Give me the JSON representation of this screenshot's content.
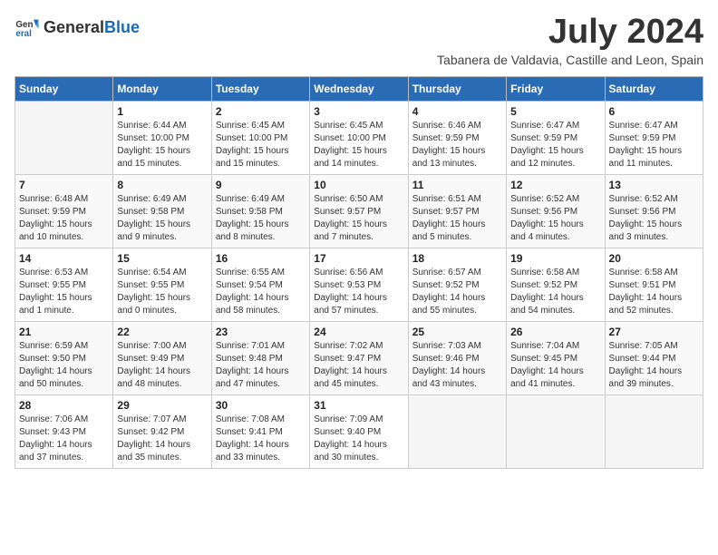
{
  "header": {
    "logo_general": "General",
    "logo_blue": "Blue",
    "month_title": "July 2024",
    "subtitle": "Tabanera de Valdavia, Castille and Leon, Spain"
  },
  "days_of_week": [
    "Sunday",
    "Monday",
    "Tuesday",
    "Wednesday",
    "Thursday",
    "Friday",
    "Saturday"
  ],
  "weeks": [
    [
      {
        "day": "",
        "info": ""
      },
      {
        "day": "1",
        "info": "Sunrise: 6:44 AM\nSunset: 10:00 PM\nDaylight: 15 hours\nand 15 minutes."
      },
      {
        "day": "2",
        "info": "Sunrise: 6:45 AM\nSunset: 10:00 PM\nDaylight: 15 hours\nand 15 minutes."
      },
      {
        "day": "3",
        "info": "Sunrise: 6:45 AM\nSunset: 10:00 PM\nDaylight: 15 hours\nand 14 minutes."
      },
      {
        "day": "4",
        "info": "Sunrise: 6:46 AM\nSunset: 9:59 PM\nDaylight: 15 hours\nand 13 minutes."
      },
      {
        "day": "5",
        "info": "Sunrise: 6:47 AM\nSunset: 9:59 PM\nDaylight: 15 hours\nand 12 minutes."
      },
      {
        "day": "6",
        "info": "Sunrise: 6:47 AM\nSunset: 9:59 PM\nDaylight: 15 hours\nand 11 minutes."
      }
    ],
    [
      {
        "day": "7",
        "info": "Sunrise: 6:48 AM\nSunset: 9:59 PM\nDaylight: 15 hours\nand 10 minutes."
      },
      {
        "day": "8",
        "info": "Sunrise: 6:49 AM\nSunset: 9:58 PM\nDaylight: 15 hours\nand 9 minutes."
      },
      {
        "day": "9",
        "info": "Sunrise: 6:49 AM\nSunset: 9:58 PM\nDaylight: 15 hours\nand 8 minutes."
      },
      {
        "day": "10",
        "info": "Sunrise: 6:50 AM\nSunset: 9:57 PM\nDaylight: 15 hours\nand 7 minutes."
      },
      {
        "day": "11",
        "info": "Sunrise: 6:51 AM\nSunset: 9:57 PM\nDaylight: 15 hours\nand 5 minutes."
      },
      {
        "day": "12",
        "info": "Sunrise: 6:52 AM\nSunset: 9:56 PM\nDaylight: 15 hours\nand 4 minutes."
      },
      {
        "day": "13",
        "info": "Sunrise: 6:52 AM\nSunset: 9:56 PM\nDaylight: 15 hours\nand 3 minutes."
      }
    ],
    [
      {
        "day": "14",
        "info": "Sunrise: 6:53 AM\nSunset: 9:55 PM\nDaylight: 15 hours\nand 1 minute."
      },
      {
        "day": "15",
        "info": "Sunrise: 6:54 AM\nSunset: 9:55 PM\nDaylight: 15 hours\nand 0 minutes."
      },
      {
        "day": "16",
        "info": "Sunrise: 6:55 AM\nSunset: 9:54 PM\nDaylight: 14 hours\nand 58 minutes."
      },
      {
        "day": "17",
        "info": "Sunrise: 6:56 AM\nSunset: 9:53 PM\nDaylight: 14 hours\nand 57 minutes."
      },
      {
        "day": "18",
        "info": "Sunrise: 6:57 AM\nSunset: 9:52 PM\nDaylight: 14 hours\nand 55 minutes."
      },
      {
        "day": "19",
        "info": "Sunrise: 6:58 AM\nSunset: 9:52 PM\nDaylight: 14 hours\nand 54 minutes."
      },
      {
        "day": "20",
        "info": "Sunrise: 6:58 AM\nSunset: 9:51 PM\nDaylight: 14 hours\nand 52 minutes."
      }
    ],
    [
      {
        "day": "21",
        "info": "Sunrise: 6:59 AM\nSunset: 9:50 PM\nDaylight: 14 hours\nand 50 minutes."
      },
      {
        "day": "22",
        "info": "Sunrise: 7:00 AM\nSunset: 9:49 PM\nDaylight: 14 hours\nand 48 minutes."
      },
      {
        "day": "23",
        "info": "Sunrise: 7:01 AM\nSunset: 9:48 PM\nDaylight: 14 hours\nand 47 minutes."
      },
      {
        "day": "24",
        "info": "Sunrise: 7:02 AM\nSunset: 9:47 PM\nDaylight: 14 hours\nand 45 minutes."
      },
      {
        "day": "25",
        "info": "Sunrise: 7:03 AM\nSunset: 9:46 PM\nDaylight: 14 hours\nand 43 minutes."
      },
      {
        "day": "26",
        "info": "Sunrise: 7:04 AM\nSunset: 9:45 PM\nDaylight: 14 hours\nand 41 minutes."
      },
      {
        "day": "27",
        "info": "Sunrise: 7:05 AM\nSunset: 9:44 PM\nDaylight: 14 hours\nand 39 minutes."
      }
    ],
    [
      {
        "day": "28",
        "info": "Sunrise: 7:06 AM\nSunset: 9:43 PM\nDaylight: 14 hours\nand 37 minutes."
      },
      {
        "day": "29",
        "info": "Sunrise: 7:07 AM\nSunset: 9:42 PM\nDaylight: 14 hours\nand 35 minutes."
      },
      {
        "day": "30",
        "info": "Sunrise: 7:08 AM\nSunset: 9:41 PM\nDaylight: 14 hours\nand 33 minutes."
      },
      {
        "day": "31",
        "info": "Sunrise: 7:09 AM\nSunset: 9:40 PM\nDaylight: 14 hours\nand 30 minutes."
      },
      {
        "day": "",
        "info": ""
      },
      {
        "day": "",
        "info": ""
      },
      {
        "day": "",
        "info": ""
      }
    ]
  ]
}
